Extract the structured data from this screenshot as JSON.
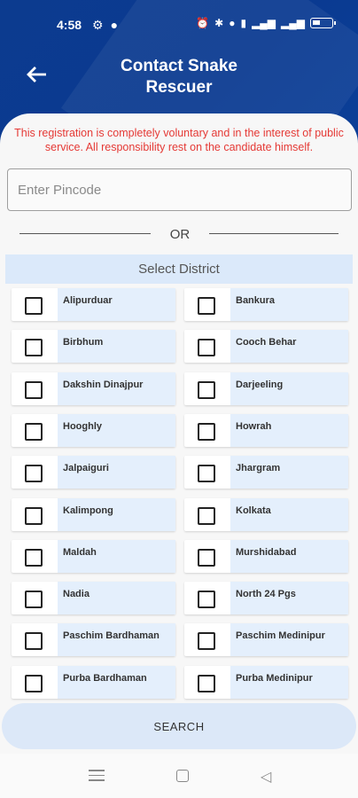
{
  "status": {
    "time": "4:58",
    "left_icons": [
      "gear-icon",
      "chat-icon"
    ],
    "right_icons": [
      "alarm-icon",
      "bluetooth-icon",
      "location-icon",
      "volte-icon",
      "signal-icon",
      "signal2-icon",
      "battery-icon"
    ]
  },
  "header": {
    "title_line1": "Contact Snake",
    "title_line2": "Rescuer",
    "back_icon": "back-arrow-icon"
  },
  "notice": "This registration is completely voluntary and in the interest of public service. All responsibility rest on the candidate himself.",
  "pincode": {
    "placeholder": "Enter Pincode",
    "value": ""
  },
  "divider_text": "OR",
  "district_header": "Select District",
  "districts": [
    {
      "label": "Alipurduar",
      "checked": false
    },
    {
      "label": "Bankura",
      "checked": false
    },
    {
      "label": "Birbhum",
      "checked": false
    },
    {
      "label": "Cooch Behar",
      "checked": false
    },
    {
      "label": "Dakshin Dinajpur",
      "checked": false
    },
    {
      "label": "Darjeeling",
      "checked": false
    },
    {
      "label": "Hooghly",
      "checked": false
    },
    {
      "label": "Howrah",
      "checked": false
    },
    {
      "label": "Jalpaiguri",
      "checked": false
    },
    {
      "label": "Jhargram",
      "checked": false
    },
    {
      "label": "Kalimpong",
      "checked": false
    },
    {
      "label": "Kolkata",
      "checked": false
    },
    {
      "label": "Maldah",
      "checked": false
    },
    {
      "label": "Murshidabad",
      "checked": false
    },
    {
      "label": "Nadia",
      "checked": false
    },
    {
      "label": "North 24 Pgs",
      "checked": false
    },
    {
      "label": "Paschim Bardhaman",
      "checked": false
    },
    {
      "label": "Paschim Medinipur",
      "checked": false
    },
    {
      "label": "Purba Bardhaman",
      "checked": false
    },
    {
      "label": "Purba Medinipur",
      "checked": false
    }
  ],
  "search_label": "SEARCH",
  "colors": {
    "header_bg": "#0c3b8f",
    "notice_text": "#e53935",
    "district_header_bg": "#dbe9fa",
    "item_label_bg": "#e4effc",
    "search_bg": "#dce8f8"
  }
}
